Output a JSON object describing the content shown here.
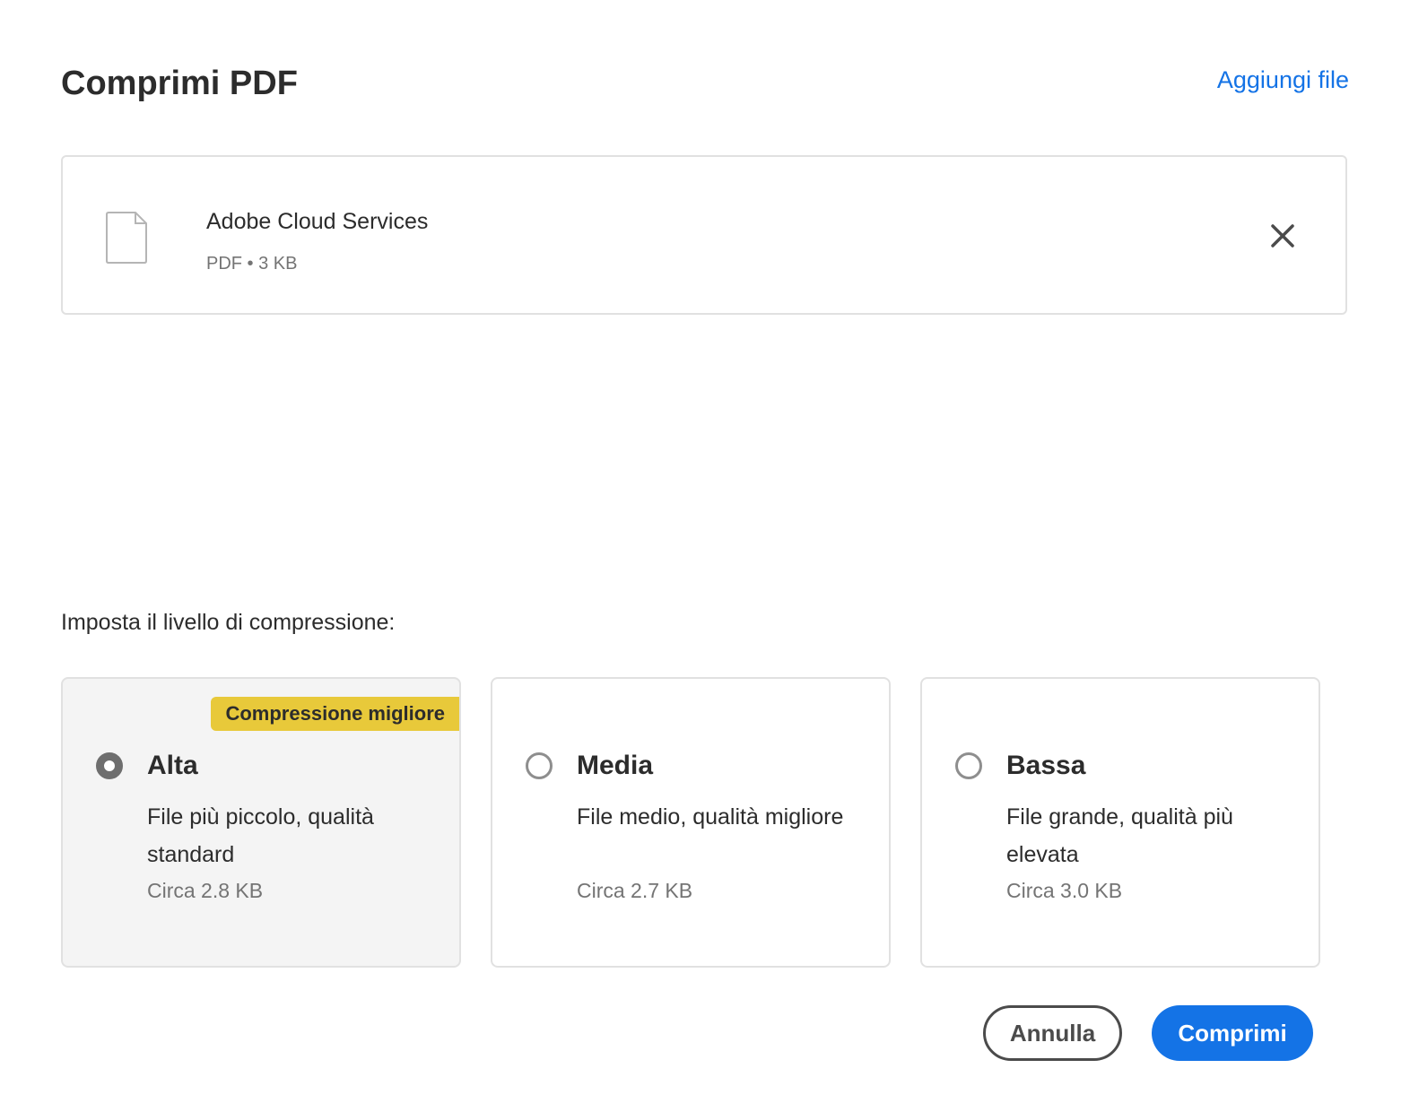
{
  "header": {
    "title": "Comprimi PDF",
    "add_file_link": "Aggiungi file"
  },
  "file": {
    "name": "Adobe Cloud Services",
    "meta": "PDF • 3 KB",
    "icon": "document-icon",
    "remove_icon": "close-icon"
  },
  "compression": {
    "label": "Imposta il livello di compressione:",
    "options": [
      {
        "title": "Alta",
        "description": "File più piccolo, qualità standard",
        "size": "Circa 2.8 KB",
        "badge": "Compressione migliore",
        "selected": true
      },
      {
        "title": "Media",
        "description": "File medio, qualità migliore",
        "size": "Circa 2.7 KB",
        "selected": false
      },
      {
        "title": "Bassa",
        "description": "File grande, qualità più elevata",
        "size": "Circa 3.0 KB",
        "selected": false
      }
    ]
  },
  "actions": {
    "cancel_label": "Annulla",
    "submit_label": "Comprimi"
  },
  "colors": {
    "accent": "#1473e6",
    "badge": "#e8c93a",
    "selected_bg": "#f4f4f4"
  }
}
